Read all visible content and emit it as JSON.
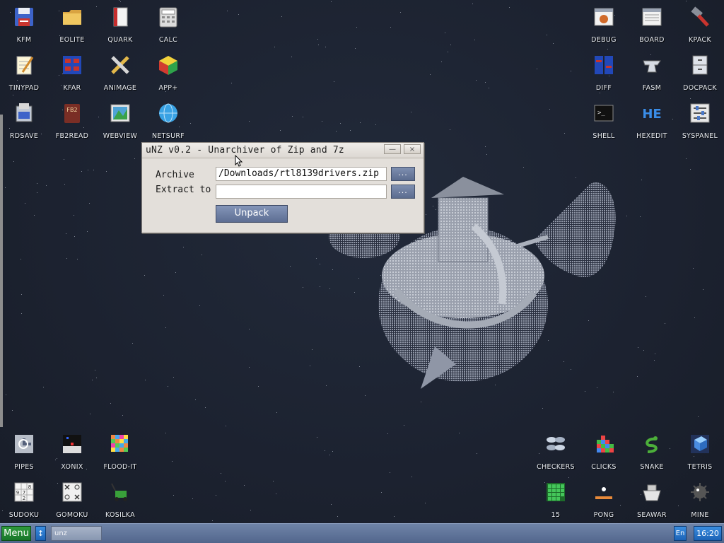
{
  "desktop": {
    "icons_top_left": [
      {
        "label": "KFM",
        "icon": "floppy-disk-icon"
      },
      {
        "label": "EOLITE",
        "icon": "folder-icon"
      },
      {
        "label": "QUARK",
        "icon": "book-icon"
      },
      {
        "label": "CALC",
        "icon": "calculator-icon"
      },
      {
        "label": "TINYPAD",
        "icon": "notepad-icon"
      },
      {
        "label": "KFAR",
        "icon": "archive-grid-icon"
      },
      {
        "label": "ANIMAGE",
        "icon": "pencil-ruler-icon"
      },
      {
        "label": "APP+",
        "icon": "rubik-cube-icon"
      },
      {
        "label": "RDSAVE",
        "icon": "ramdisk-icon"
      },
      {
        "label": "FB2READ",
        "icon": "fb2-book-icon"
      },
      {
        "label": "WEBVIEW",
        "icon": "map-picture-icon"
      },
      {
        "label": "NETSURF",
        "icon": "globe-icon"
      }
    ],
    "icons_top_right": [
      {
        "label": "DEBUG",
        "icon": "bug-window-icon"
      },
      {
        "label": "BOARD",
        "icon": "board-window-icon"
      },
      {
        "label": "KPACK",
        "icon": "hammer-icon"
      },
      {
        "label": "DIFF",
        "icon": "diff-grid-icon"
      },
      {
        "label": "FASM",
        "icon": "anvil-icon"
      },
      {
        "label": "DOCPACK",
        "icon": "cabinet-icon"
      },
      {
        "label": "SHELL",
        "icon": "terminal-icon"
      },
      {
        "label": "HEXEDIT",
        "icon": "hex-icon"
      },
      {
        "label": "SYSPANEL",
        "icon": "sliders-icon"
      }
    ],
    "icons_bottom_left": [
      {
        "label": "PIPES",
        "icon": "pipes-icon"
      },
      {
        "label": "XONIX",
        "icon": "xonix-icon"
      },
      {
        "label": "FLOOD-IT",
        "icon": "color-grid-icon"
      },
      {
        "label": "SUDOKU",
        "icon": "sudoku-icon"
      },
      {
        "label": "GOMOKU",
        "icon": "gomoku-icon"
      },
      {
        "label": "KOSILKA",
        "icon": "lawnmower-icon"
      }
    ],
    "icons_bottom_right": [
      {
        "label": "CHECKERS",
        "icon": "checkers-icon"
      },
      {
        "label": "CLICKS",
        "icon": "blocks-icon"
      },
      {
        "label": "SNAKE",
        "icon": "snake-icon"
      },
      {
        "label": "TETRIS",
        "icon": "tetris-icon"
      },
      {
        "label": "15",
        "icon": "fifteen-puzzle-icon"
      },
      {
        "label": "PONG",
        "icon": "pong-icon"
      },
      {
        "label": "SEAWAR",
        "icon": "battleship-icon"
      },
      {
        "label": "MINE",
        "icon": "mine-icon"
      }
    ],
    "sudoku_digits": [
      "9",
      "7",
      "8",
      "2"
    ]
  },
  "dialog": {
    "title": "uNZ v0.2 - Unarchiver of Zip and 7z",
    "minimize_label": "—",
    "close_label": "×",
    "archive_label": "Archive",
    "archive_value": "/Downloads/rtl8139drivers.zip",
    "extract_label": "Extract to",
    "extract_value": "",
    "browse_label": "...",
    "unpack_label": "Unpack"
  },
  "taskbar": {
    "menu_label": "Menu",
    "switch_label": "↕",
    "task_label": "unz",
    "lang_label": "En",
    "clock": "16:20"
  }
}
